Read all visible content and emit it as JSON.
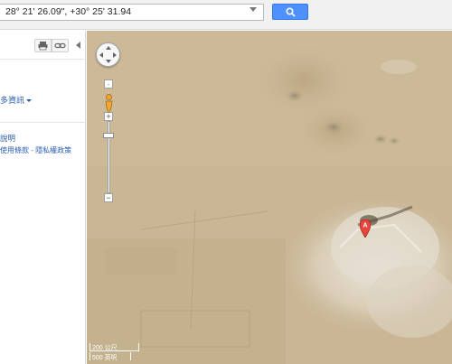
{
  "search": {
    "value": "28° 21' 26.09\", +30° 25' 31.94",
    "button_icon": "magnifier-icon"
  },
  "side_panel": {
    "print_icon": "print-icon",
    "link_icon": "link-icon",
    "more_info": "多資訊",
    "help": "說明",
    "terms": "使用條款",
    "separator": "-",
    "privacy": "隱私權政策"
  },
  "map": {
    "marker_label": "A",
    "marker_color": "#e8453c",
    "scale_label_imperial": "200 公尺",
    "scale_label_metric": "500 英呎"
  },
  "colors": {
    "search_button": "#4d90fe",
    "link": "#2a5db0",
    "desert": "#c8b594"
  }
}
